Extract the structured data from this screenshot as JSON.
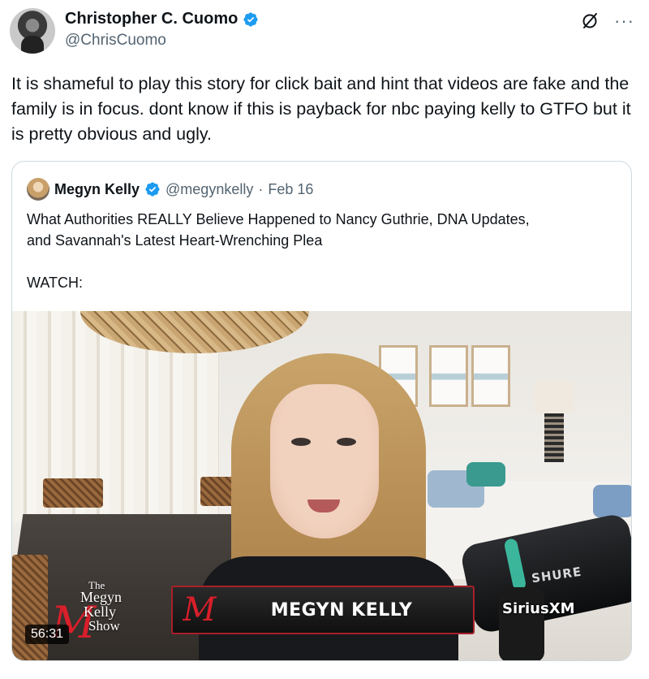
{
  "post": {
    "author_name": "Christopher C. Cuomo",
    "author_handle": "@ChrisCuomo",
    "text": "It is shameful to play this story for click bait and hint that videos are fake and the family is in focus. dont know if this is payback for nbc paying kelly to GTFO but it is pretty obvious and ugly."
  },
  "quoted_post": {
    "author_name": "Megyn Kelly",
    "author_handle": "@megynkelly",
    "separator": "·",
    "date": "Feb 16",
    "text": "What Authorities REALLY Believe Happened to Nancy Guthrie, DNA Updates,\nand Savannah's Latest Heart-Wrenching Plea\n\nWATCH:"
  },
  "video": {
    "show_logo": {
      "line1": "The",
      "line2": "Megyn",
      "line3": "Kelly",
      "line4": "Show",
      "m": "M"
    },
    "lower_third_m": "M",
    "lower_third_name": "MEGYN KELLY",
    "mic_brand": "SHURE",
    "channel_brand": "SiriusXM",
    "duration": "56:31"
  },
  "icons": {
    "verified": "verified-badge-icon",
    "grok": "grok-icon",
    "more": "more-icon"
  },
  "colors": {
    "verified_blue": "#1d9bf0",
    "secondary_text": "#536471",
    "border": "#cfd9de",
    "brand_red": "#d81f2a"
  }
}
